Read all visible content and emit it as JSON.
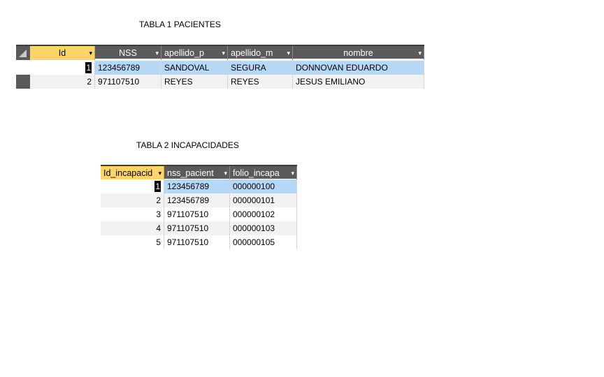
{
  "table1": {
    "caption": "TABLA 1 PACIENTES",
    "columns": [
      "Id",
      "NSS",
      "apellido_p",
      "apellido_m",
      "nombre"
    ],
    "rows": [
      {
        "id": "1",
        "nss": "123456789",
        "apellido_p": "SANDOVAL",
        "apellido_m": "SEGURA",
        "nombre": "DONNOVAN EDUARDO"
      },
      {
        "id": "2",
        "nss": "971107510",
        "apellido_p": "REYES",
        "apellido_m": "REYES",
        "nombre": "JESUS EMILIANO"
      }
    ]
  },
  "table2": {
    "caption": "TABLA 2 INCAPACIDADES",
    "columns": [
      "Id_incapacid",
      "nss_pacient",
      "folio_incapa"
    ],
    "rows": [
      {
        "id": "1",
        "nss": "123456789",
        "folio": "000000100"
      },
      {
        "id": "2",
        "nss": "123456789",
        "folio": "000000101"
      },
      {
        "id": "3",
        "nss": "971107510",
        "folio": "000000102"
      },
      {
        "id": "4",
        "nss": "971107510",
        "folio": "000000103"
      },
      {
        "id": "5",
        "nss": "971107510",
        "folio": "000000105"
      }
    ]
  },
  "colors": {
    "header_bg": "#5a5a5a",
    "selected_header": "#fcd56a",
    "current_row": "#b7d7f7",
    "alt_row": "#f2f2f2"
  },
  "icons": {
    "dropdown": "dropdown-arrow-icon",
    "select_all": "select-all-corner-icon"
  }
}
